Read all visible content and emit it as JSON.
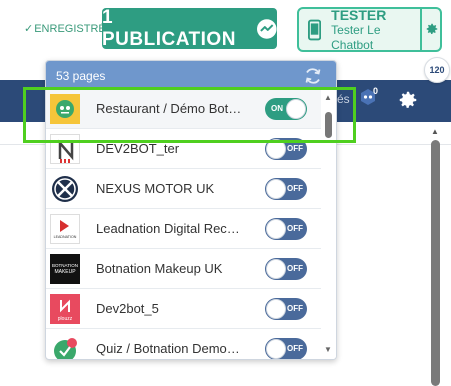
{
  "topbar": {
    "saved_check": "✓",
    "saved_label": "ENREGISTRÉ",
    "publish_label": "1 PUBLICATION",
    "tester_title": "TESTER",
    "tester_subtitle": "Tester Le Chatbot",
    "counter_badge": "120"
  },
  "navbar": {
    "partial_text": "és",
    "robot_badge": "0"
  },
  "dropdown": {
    "pages_count": "53 pages",
    "items": [
      {
        "name": "Restaurant / Démo Bot…",
        "toggle": "ON",
        "state": "on"
      },
      {
        "name": "DEV2BOT_ter",
        "toggle": "OFF",
        "state": "off"
      },
      {
        "name": "NEXUS MOTOR UK",
        "toggle": "OFF",
        "state": "off"
      },
      {
        "name": "Leadnation Digital Rec…",
        "toggle": "OFF",
        "state": "off"
      },
      {
        "name": "Botnation Makeup UK",
        "toggle": "OFF",
        "state": "off"
      },
      {
        "name": "Dev2bot_5",
        "toggle": "OFF",
        "state": "off"
      },
      {
        "name": "Quiz / Botnation Demo…",
        "toggle": "OFF",
        "state": "off"
      }
    ],
    "avatar_texts": {
      "leadnation": "LEADNATION",
      "makeup_line1": "BOTNATION",
      "makeup_line2": "MAKEUP",
      "dev2bot": "plouzz"
    }
  },
  "colors": {
    "accent_green": "#2e9d82",
    "navbar_blue": "#2c4a78",
    "header_blue": "#6f97cc",
    "highlight_green": "#4fcf1f"
  }
}
